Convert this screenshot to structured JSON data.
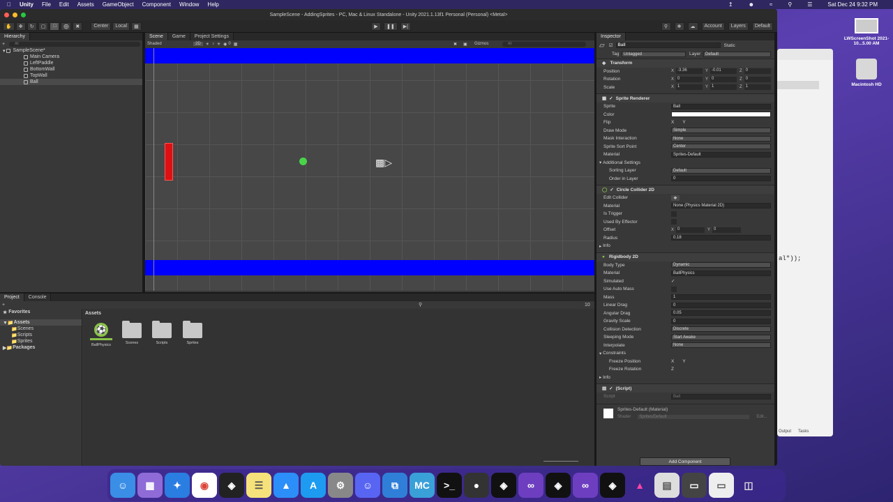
{
  "menubar": {
    "app": "Unity",
    "items": [
      "File",
      "Edit",
      "Assets",
      "GameObject",
      "Component",
      "Window",
      "Help"
    ],
    "clock": "Sat Dec 24  9:32 PM"
  },
  "window": {
    "title": "SampleScene - AddingSprites - PC, Mac & Linux Standalone - Unity 2021.1.13f1 Personal (Personal) <Metal>"
  },
  "toolbar": {
    "pivot": "Center",
    "space": "Local",
    "account": "Account",
    "layers": "Layers",
    "layout": "Default"
  },
  "tabs": {
    "hierarchy": "Hierarchy",
    "scene": "Scene",
    "game": "Game",
    "project_settings": "Project Settings",
    "inspector": "Inspector",
    "project": "Project",
    "console": "Console"
  },
  "hierarchy": {
    "search_placeholder": "All",
    "scene": "SampleScene*",
    "objects": [
      "Main Camera",
      "LeftPaddle",
      "BottomWall",
      "TopWall",
      "Ball"
    ]
  },
  "scene": {
    "shading": "Shaded",
    "mode_2d": "2D",
    "gizmos": "Gizmos",
    "search_placeholder": "All",
    "layer_count": "0"
  },
  "project": {
    "favorites": "Favorites",
    "assets_root": "Assets",
    "folders": [
      "Scenes",
      "Scripts",
      "Sprites"
    ],
    "packages": "Packages",
    "breadcrumb": "Assets",
    "tiles": [
      "BallPhysics",
      "Scenes",
      "Scripts",
      "Sprites"
    ],
    "count": "10"
  },
  "inspector": {
    "object_name": "Ball",
    "static": "Static",
    "tag_label": "Tag",
    "tag": "Untagged",
    "layer_label": "Layer",
    "layer": "Default",
    "transform": {
      "title": "Transform",
      "position_label": "Position",
      "px": "-3.36",
      "py": "-0.01",
      "pz": "0",
      "rotation_label": "Rotation",
      "rx": "0",
      "ry": "0",
      "rz": "0",
      "scale_label": "Scale",
      "sx": "1",
      "sy": "1",
      "sz": "1"
    },
    "sprite_renderer": {
      "title": "Sprite Renderer",
      "sprite_label": "Sprite",
      "sprite": "Ball",
      "color_label": "Color",
      "flip_label": "Flip",
      "flip_x": "X",
      "flip_y": "Y",
      "draw_mode_label": "Draw Mode",
      "draw_mode": "Simple",
      "mask_label": "Mask Interaction",
      "mask": "None",
      "sort_point_label": "Sprite Sort Point",
      "sort_point": "Center",
      "material_label": "Material",
      "material": "Sprites-Default",
      "additional": "Additional Settings",
      "sorting_layer_label": "Sorting Layer",
      "sorting_layer": "Default",
      "order_label": "Order in Layer",
      "order": "0"
    },
    "circle_collider": {
      "title": "Circle Collider 2D",
      "edit_label": "Edit Collider",
      "material_label": "Material",
      "material": "None (Physics Material 2D)",
      "trigger_label": "Is Trigger",
      "effector_label": "Used By Effector",
      "offset_label": "Offset",
      "ox": "0",
      "oy": "0",
      "radius_label": "Radius",
      "radius": "0.18",
      "info": "Info"
    },
    "rigidbody": {
      "title": "Rigidbody 2D",
      "body_type_label": "Body Type",
      "body_type": "Dynamic",
      "material_label": "Material",
      "material": "BallPhysics",
      "simulated_label": "Simulated",
      "auto_mass_label": "Use Auto Mass",
      "mass_label": "Mass",
      "mass": "1",
      "linear_drag_label": "Linear Drag",
      "linear_drag": "0",
      "angular_drag_label": "Angular Drag",
      "angular_drag": "0.05",
      "gravity_label": "Gravity Scale",
      "gravity": "0",
      "collision_label": "Collision Detection",
      "collision": "Discrete",
      "sleeping_label": "Sleeping Mode",
      "sleeping": "Start Awake",
      "interpolate_label": "Interpolate",
      "interpolate": "None",
      "constraints": "Constraints",
      "freeze_pos_label": "Freeze Position",
      "fp_x": "X",
      "fp_y": "Y",
      "freeze_rot_label": "Freeze Rotation",
      "fr_z": "Z",
      "info": "Info"
    },
    "script": {
      "title": "(Script)",
      "script_label": "Script",
      "script_value": "Ball"
    },
    "material_preview": {
      "name": "Sprites-Default (Material)",
      "shader_label": "Shader",
      "shader": "Sprites/Default",
      "edit": "Edit..."
    },
    "add_component": "Add Component"
  },
  "desktop": {
    "screenshot_label": "LWScreenShot 2021-10...5.00 AM",
    "hd_label": "Macintosh HD",
    "code_snippet": "al\"));",
    "finder_output": "Output",
    "finder_tasks": "Tasks"
  },
  "colors": {
    "wall": "#0000ff",
    "paddle": "#dd1111",
    "ball": "#4ad44a",
    "editor_bg": "#383838"
  }
}
